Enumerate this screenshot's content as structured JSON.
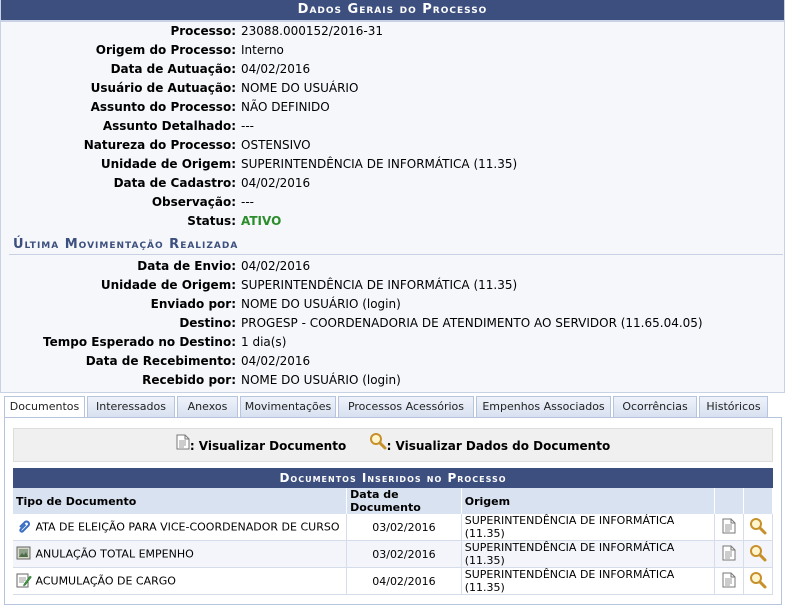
{
  "header": {
    "title": "Dados Gerais do Processo"
  },
  "process": [
    {
      "label": "Processo:",
      "value": "23088.000152/2016-31"
    },
    {
      "label": "Origem do Processo:",
      "value": "Interno"
    },
    {
      "label": "Data de Autuação:",
      "value": "04/02/2016"
    },
    {
      "label": "Usuário de Autuação:",
      "value": "NOME DO USUÁRIO"
    },
    {
      "label": "Assunto do Processo:",
      "value": "NÃO DEFINIDO"
    },
    {
      "label": "Assunto Detalhado:",
      "value": "---"
    },
    {
      "label": "Natureza do Processo:",
      "value": "OSTENSIVO"
    },
    {
      "label": "Unidade de Origem:",
      "value": "SUPERINTENDÊNCIA DE INFORMÁTICA (11.35)"
    },
    {
      "label": "Data de Cadastro:",
      "value": "04/02/2016"
    },
    {
      "label": "Observação:",
      "value": "---"
    },
    {
      "label": "Status:",
      "value": "ATIVO"
    }
  ],
  "last_movement": {
    "title": "Última Movimentação Realizada",
    "rows": [
      {
        "label": "Data de Envio:",
        "value": "04/02/2016"
      },
      {
        "label": "Unidade de Origem:",
        "value": "SUPERINTENDÊNCIA DE INFORMÁTICA (11.35)"
      },
      {
        "label": "Enviado por:",
        "value": "NOME DO USUÁRIO (login)"
      },
      {
        "label": "Destino:",
        "value": "PROGESP - COORDENADORIA DE ATENDIMENTO AO SERVIDOR (11.65.04.05)"
      },
      {
        "label": "Tempo Esperado no Destino:",
        "value": "1 dia(s)"
      },
      {
        "label": "Data de Recebimento:",
        "value": "04/02/2016"
      },
      {
        "label": "Recebido por:",
        "value": "NOME DO USUÁRIO (login)"
      }
    ]
  },
  "tabs": [
    "Documentos",
    "Interessados",
    "Anexos",
    "Movimentações",
    "Processos Acessórios",
    "Empenhos Associados",
    "Ocorrências",
    "Históricos"
  ],
  "legend": {
    "view_doc": ": Visualizar Documento",
    "view_data": ": Visualizar Dados do Documento"
  },
  "documents": {
    "title": "Documentos Inseridos no Processo",
    "columns": [
      "Tipo de Documento",
      "Data de Documento",
      "Origem"
    ],
    "rows": [
      {
        "type": "ATA DE ELEIÇÃO PARA VICE-COORDENADOR DE CURSO",
        "date": "03/02/2016",
        "origin": "SUPERINTENDÊNCIA DE INFORMÁTICA (11.35)",
        "icon": "paperclip-icon"
      },
      {
        "type": "ANULAÇÃO TOTAL EMPENHO",
        "date": "03/02/2016",
        "origin": "SUPERINTENDÊNCIA DE INFORMÁTICA (11.35)",
        "icon": "scanned-document-icon"
      },
      {
        "type": "ACUMULAÇÃO DE CARGO",
        "date": "04/02/2016",
        "origin": "SUPERINTENDÊNCIA DE INFORMÁTICA (11.35)",
        "icon": "edit-document-icon"
      }
    ]
  },
  "colors": {
    "header": "#3d4f7e",
    "status_active": "#2a8c2a",
    "tab_border": "#b7c4de"
  }
}
